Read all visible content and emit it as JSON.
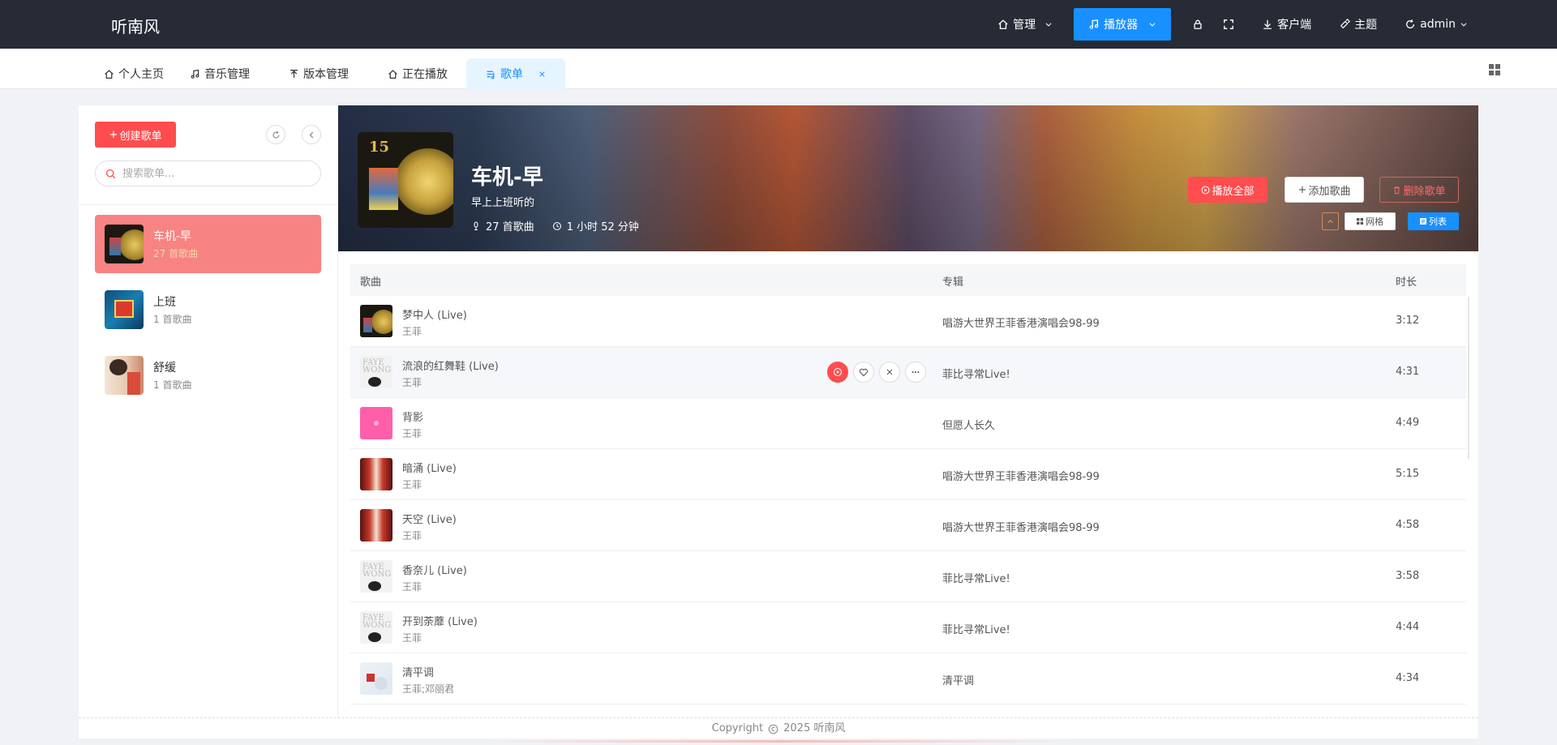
{
  "app": {
    "brand": "听南风"
  },
  "topnav": {
    "manage_label": "管理",
    "player_label": "播放器",
    "client_label": "客户端",
    "theme_label": "主题",
    "user_label": "admin"
  },
  "tabs": [
    {
      "label": "个人主页",
      "icon": "home-icon"
    },
    {
      "label": "音乐管理",
      "icon": "music-note-icon"
    },
    {
      "label": "版本管理",
      "icon": "upload-icon"
    },
    {
      "label": "正在播放",
      "icon": "home-icon"
    },
    {
      "label": "歌单",
      "icon": "playlist-icon",
      "active": true
    }
  ],
  "sidebar": {
    "create_label": "创建歌单",
    "search_placeholder": "搜索歌单...",
    "playlists": [
      {
        "name": "车机-早",
        "count": "27 首歌曲",
        "active": true
      },
      {
        "name": "上班",
        "count": "1 首歌曲"
      },
      {
        "name": "舒缓",
        "count": "1 首歌曲"
      }
    ]
  },
  "playlist": {
    "title": "车机-早",
    "description": "早上上班听的",
    "song_count": "27 首歌曲",
    "duration": "1 小时 52 分钟",
    "play_all_label": "播放全部",
    "add_song_label": "添加歌曲",
    "delete_label": "删除歌单",
    "grid_label": "网格",
    "list_label": "列表"
  },
  "table": {
    "headers": {
      "song": "歌曲",
      "album": "专辑",
      "duration": "时长"
    },
    "rows": [
      {
        "title": "梦中人 (Live)",
        "artist": "王菲",
        "album": "唱游大世界王菲香港演唱会98-99",
        "duration": "3:12"
      },
      {
        "title": "流浪的红舞鞋 (Live)",
        "artist": "王菲",
        "album": "菲比寻常Live!",
        "duration": "4:31"
      },
      {
        "title": "背影",
        "artist": "王菲",
        "album": "但愿人长久",
        "duration": "4:49"
      },
      {
        "title": "暗涌 (Live)",
        "artist": "王菲",
        "album": "唱游大世界王菲香港演唱会98-99",
        "duration": "5:15"
      },
      {
        "title": "天空 (Live)",
        "artist": "王菲",
        "album": "唱游大世界王菲香港演唱会98-99",
        "duration": "4:58"
      },
      {
        "title": "香奈儿 (Live)",
        "artist": "王菲",
        "album": "菲比寻常Live!",
        "duration": "3:58"
      },
      {
        "title": "开到荼蘼 (Live)",
        "artist": "王菲",
        "album": "菲比寻常Live!",
        "duration": "4:44"
      },
      {
        "title": "清平调",
        "artist": "王菲;邓丽君",
        "album": "清平调",
        "duration": "4:34"
      }
    ]
  },
  "footer": {
    "text": "Copyright",
    "year_brand": "2025 听南风"
  },
  "colors": {
    "accent_blue": "#1890ff",
    "accent_red": "#ff4d4f",
    "active_playlist": "#f88383",
    "topbar": "#262b36"
  }
}
